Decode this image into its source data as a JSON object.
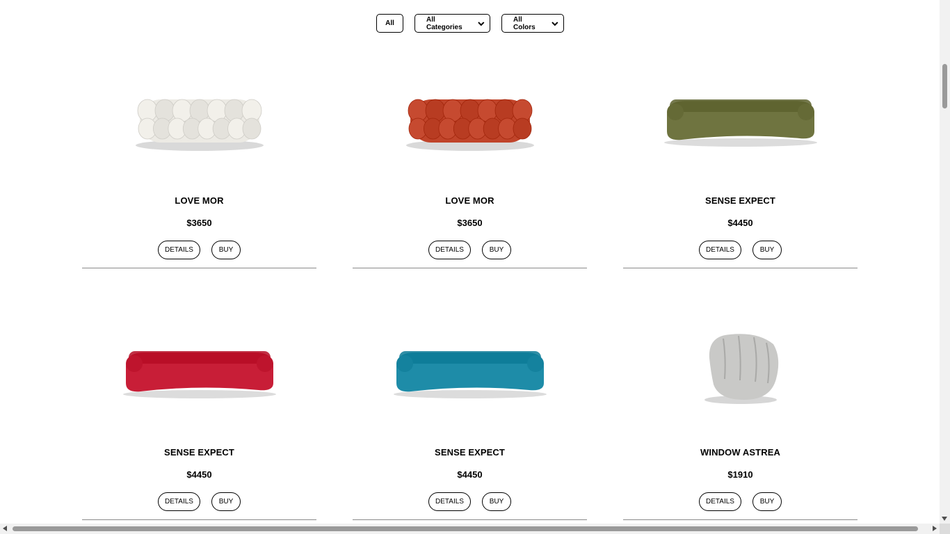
{
  "filters": {
    "all_label": "All",
    "category_selected": "All Categories",
    "color_selected": "All Colors"
  },
  "products": [
    {
      "name": "LOVE MOR",
      "price": "$3650",
      "details_label": "DETAILS",
      "buy_label": "BUY",
      "image": "bubble-sofa",
      "color": "#eceae4"
    },
    {
      "name": "LOVE MOR",
      "price": "$3650",
      "details_label": "DETAILS",
      "buy_label": "BUY",
      "image": "bubble-sofa",
      "color": "#c0442a"
    },
    {
      "name": "SENSE EXPECT",
      "price": "$4450",
      "details_label": "DETAILS",
      "buy_label": "BUY",
      "image": "long-sofa",
      "color": "#6f7440"
    },
    {
      "name": "SENSE EXPECT",
      "price": "$4450",
      "details_label": "DETAILS",
      "buy_label": "BUY",
      "image": "long-sofa",
      "color": "#c81e37"
    },
    {
      "name": "SENSE EXPECT",
      "price": "$4450",
      "details_label": "DETAILS",
      "buy_label": "BUY",
      "image": "long-sofa",
      "color": "#1e8ca8"
    },
    {
      "name": "WINDOW ASTREA",
      "price": "$1910",
      "details_label": "DETAILS",
      "buy_label": "BUY",
      "image": "armchair",
      "color": "#c9c9c7"
    }
  ]
}
